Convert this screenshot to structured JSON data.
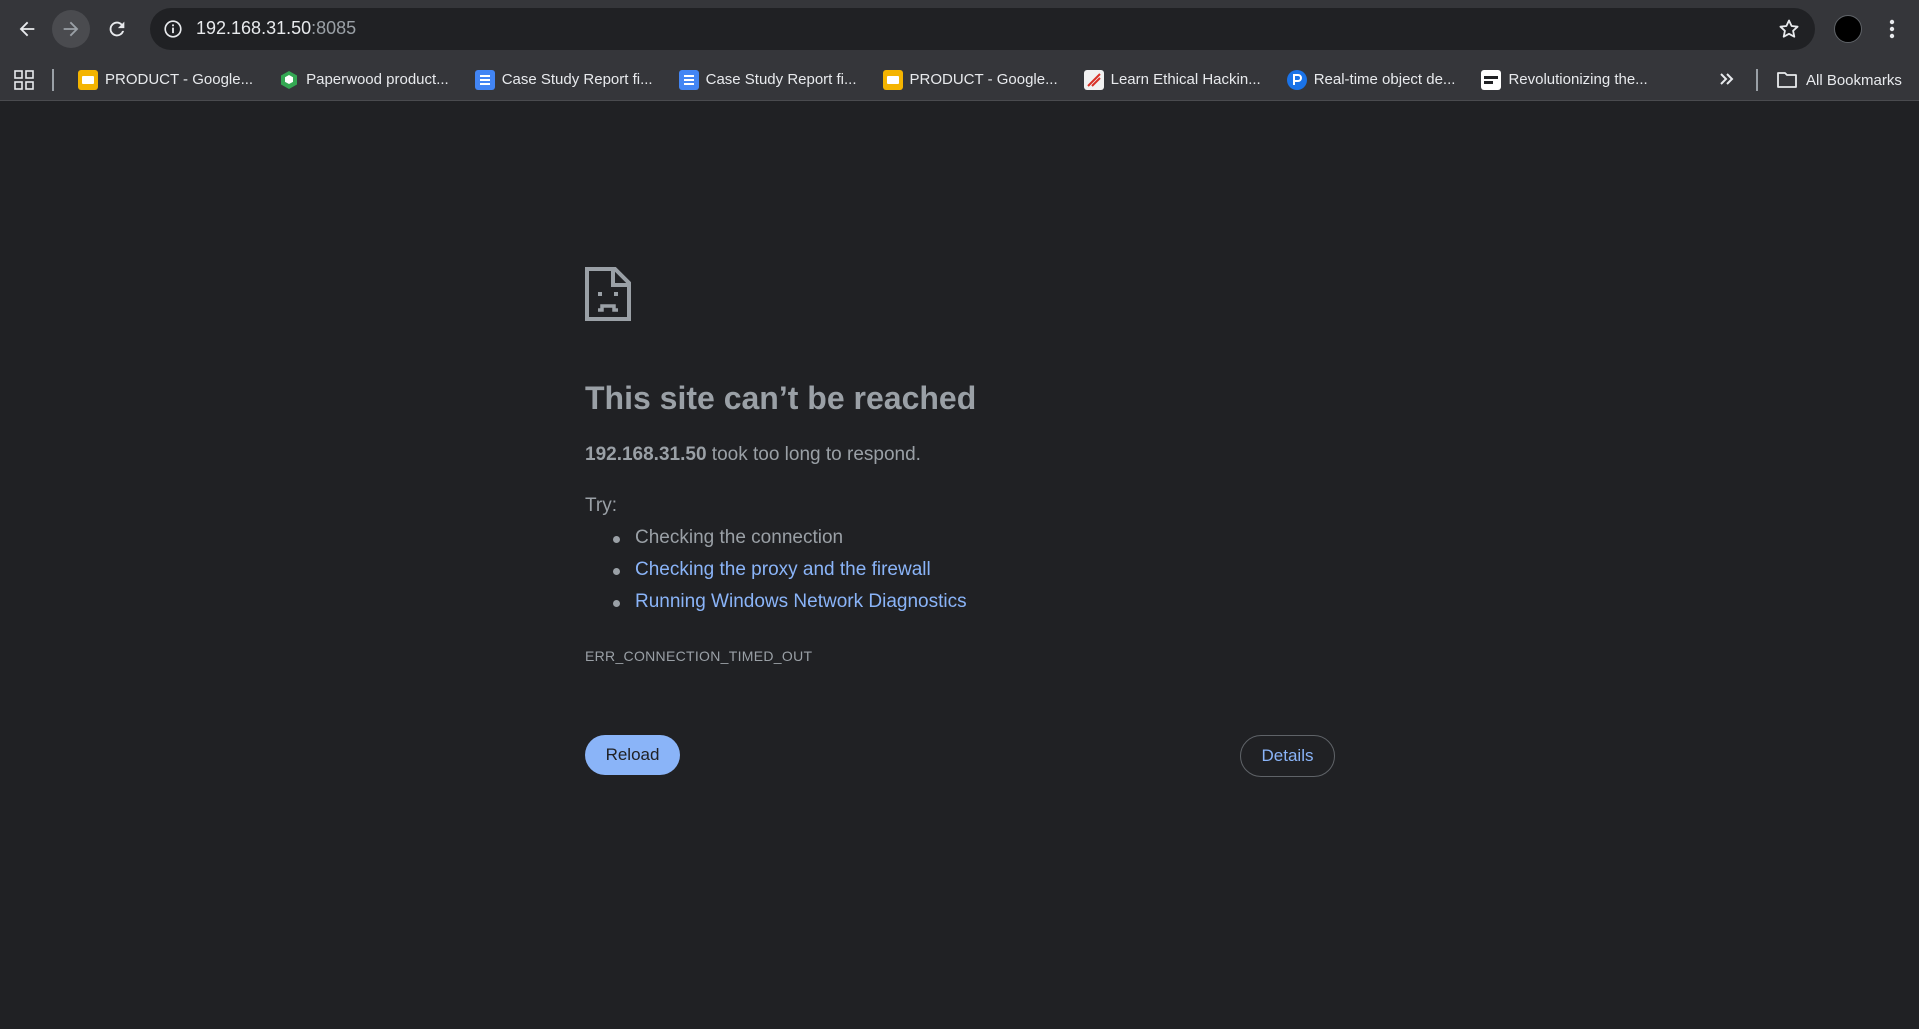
{
  "browser": {
    "address": {
      "host": "192.168.31.50",
      "port": ":8085"
    },
    "bookmarks": [
      {
        "icon": "slides-icon",
        "label": "PRODUCT - Google..."
      },
      {
        "icon": "paperwood-icon",
        "label": "Paperwood product..."
      },
      {
        "icon": "docs-icon",
        "label": "Case Study Report fi..."
      },
      {
        "icon": "docs-icon",
        "label": "Case Study Report fi..."
      },
      {
        "icon": "slides-icon",
        "label": "PRODUCT - Google..."
      },
      {
        "icon": "hacking-icon",
        "label": "Learn Ethical Hackin..."
      },
      {
        "icon": "pp-icon",
        "label": "Real-time object de..."
      },
      {
        "icon": "revolution-icon",
        "label": "Revolutionizing the..."
      }
    ],
    "all_bookmarks_label": "All Bookmarks"
  },
  "error": {
    "title": "This site can’t be reached",
    "host": "192.168.31.50",
    "message": " took too long to respond.",
    "try_label": "Try:",
    "suggestions": [
      "Checking the connection",
      "Checking the proxy and the firewall",
      "Running Windows Network Diagnostics"
    ],
    "code": "ERR_CONNECTION_TIMED_OUT",
    "reload_label": "Reload",
    "details_label": "Details"
  },
  "colors": {
    "page_bg": "#202124",
    "toolbar_bg": "#35363a",
    "link": "#8ab4f8",
    "text": "#9aa0a6"
  }
}
